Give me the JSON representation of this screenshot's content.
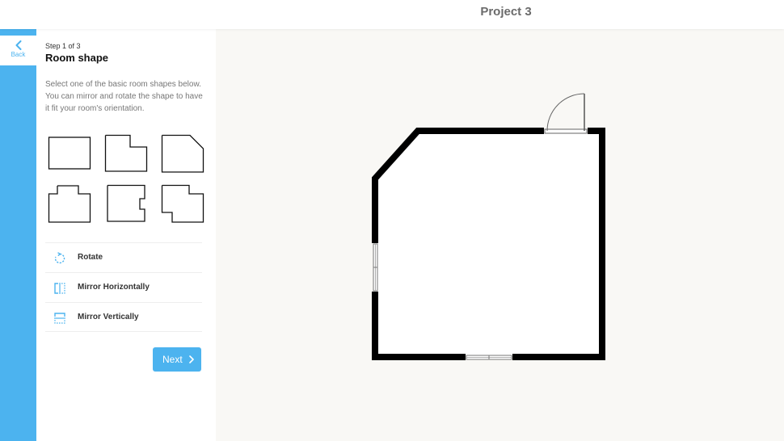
{
  "header": {
    "project_title": "Project 3"
  },
  "nav": {
    "back_label": "Back"
  },
  "panel": {
    "step_label": "Step 1 of 3",
    "title": "Room shape",
    "instructions": "Select one of the basic room shapes below. You can mirror and rotate the shape to have it fit your room's orientation.",
    "shapes": [
      "rectangle",
      "l-shape",
      "cut-corner",
      "t-shape",
      "u-shape",
      "z-shape"
    ],
    "tools": [
      {
        "label": "Rotate",
        "icon": "rotate-icon"
      },
      {
        "label": "Mirror Horizontally",
        "icon": "mirror-horizontal-icon"
      },
      {
        "label": "Mirror Vertically",
        "icon": "mirror-vertical-icon"
      }
    ],
    "next_label": "Next"
  },
  "colors": {
    "accent": "#4cb3ef",
    "canvas_bg": "#f9f8f5",
    "wall": "#000000"
  }
}
